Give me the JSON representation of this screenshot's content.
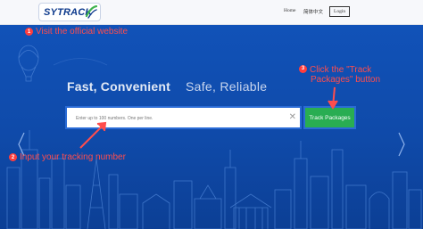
{
  "header": {
    "logo_text": "SYTRACK",
    "nav": [
      {
        "label": "Home"
      },
      {
        "label": "简体中文"
      },
      {
        "label": "Login"
      }
    ]
  },
  "hero": {
    "headline_left": "Fast, Convenient",
    "headline_right": "Safe, Reliable"
  },
  "search": {
    "placeholder": "Enter up to 100 numbers. One per line.",
    "button_label": "Track Packages"
  },
  "steps": [
    {
      "number": "1",
      "text": "Visit the official website"
    },
    {
      "number": "2",
      "text": "Input your tracking number"
    },
    {
      "number": "3",
      "text_line1": "Click the \"Track",
      "text_line2": "Packages\" button"
    }
  ],
  "colors": {
    "hero_blue": "#0f4aa9",
    "button_green": "#29ad52",
    "annotation_red": "#ff4d4d"
  }
}
